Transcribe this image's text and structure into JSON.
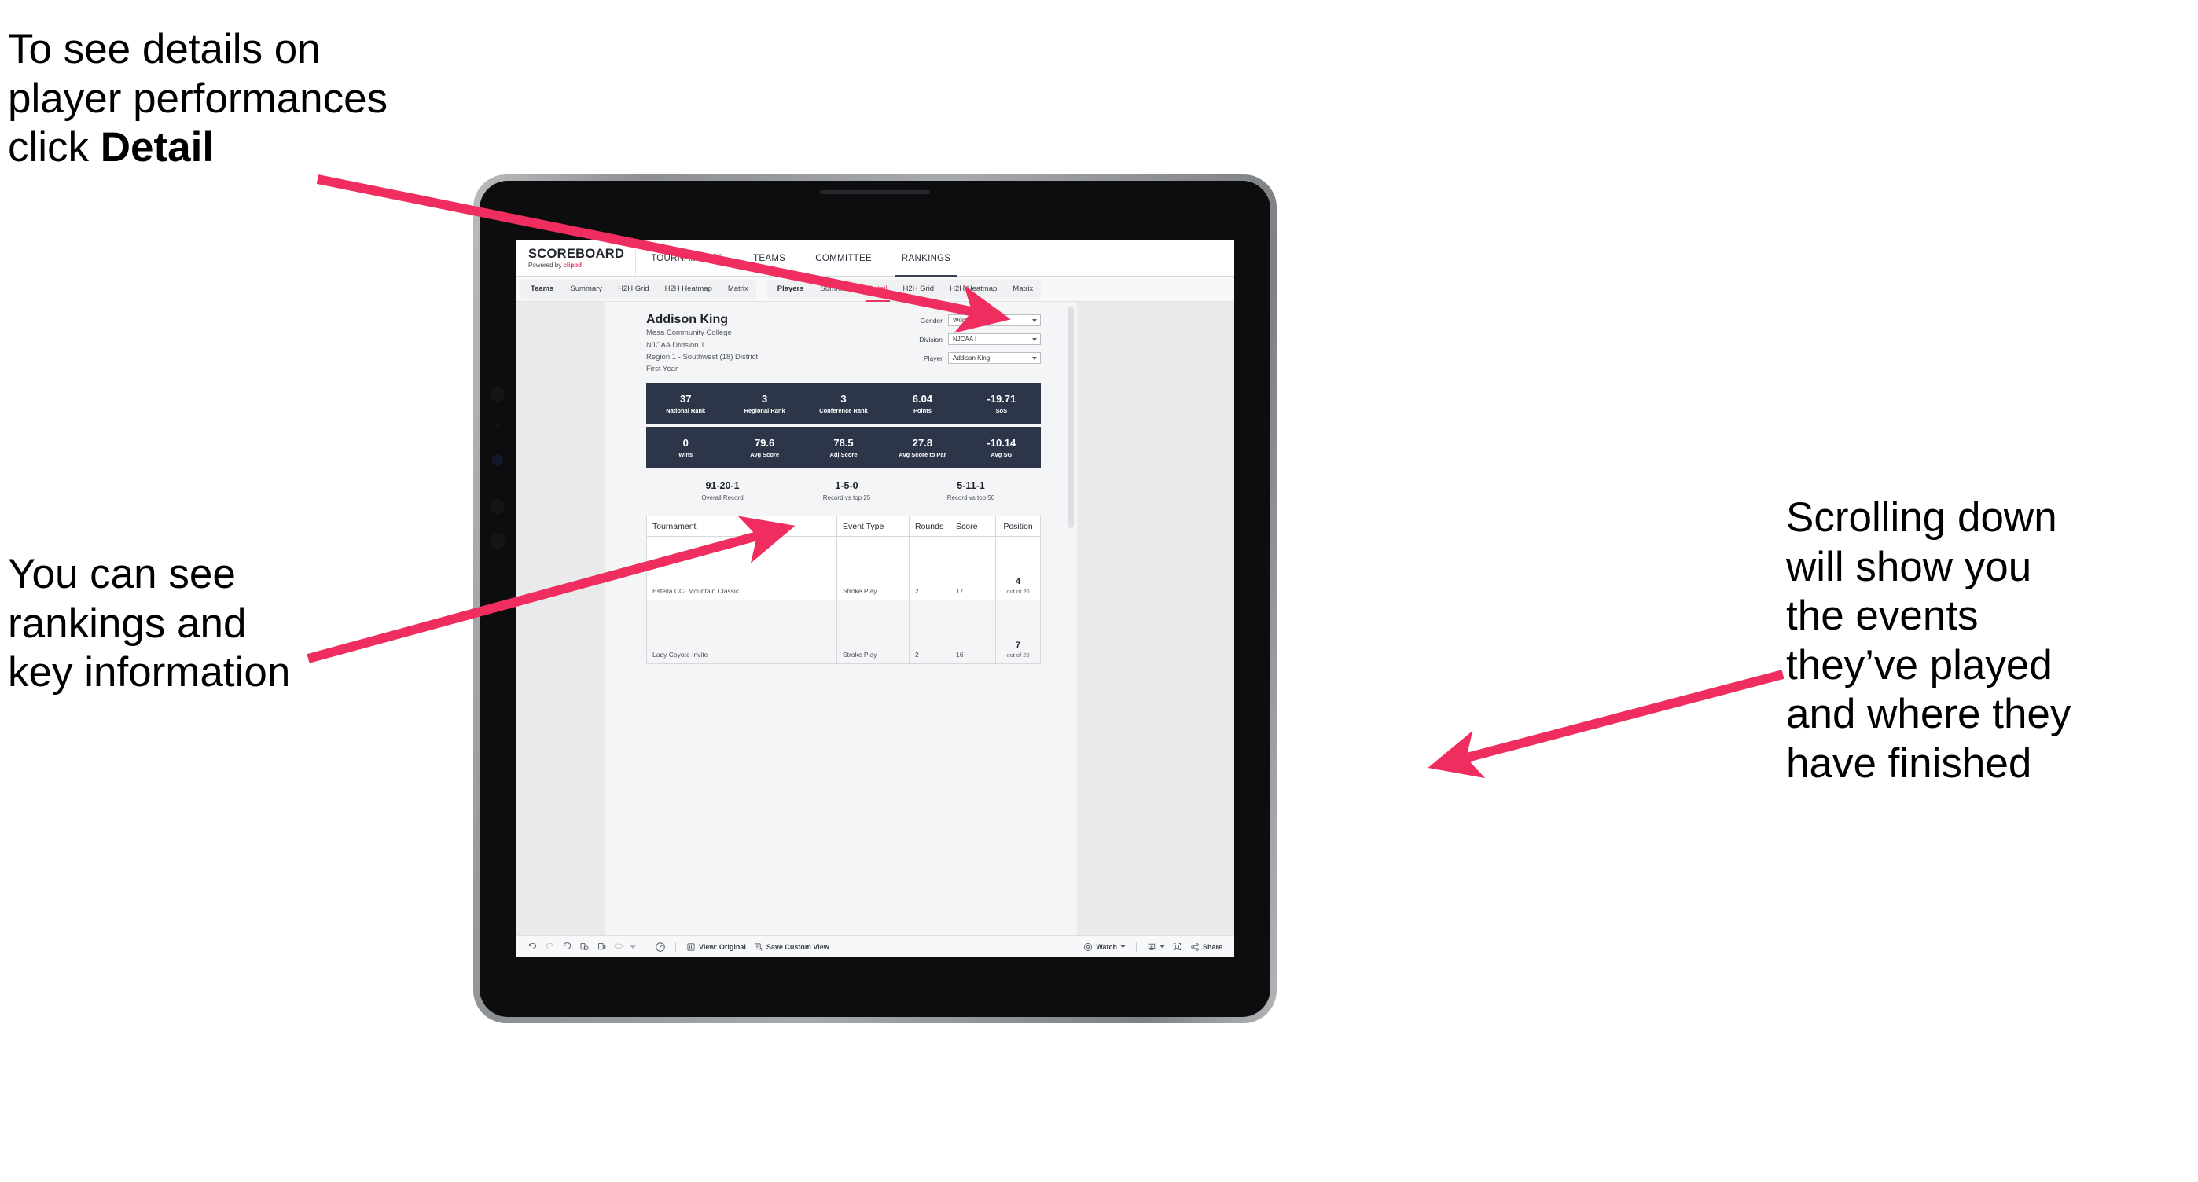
{
  "annotations": {
    "top_left": "To see details on\nplayer performances\nclick ",
    "top_left_bold": "Detail",
    "mid_left": "You can see\nrankings and\nkey information",
    "right": "Scrolling down\nwill show you\nthe events\nthey’ve played\nand where they\nhave finished"
  },
  "app": {
    "brand": {
      "main": "SCOREBOARD",
      "powered_prefix": "Powered by ",
      "powered_accent": "clippd"
    },
    "topnav": [
      {
        "label": "TOURNAMENTS",
        "active": false
      },
      {
        "label": "TEAMS",
        "active": false
      },
      {
        "label": "COMMITTEE",
        "active": false
      },
      {
        "label": "RANKINGS",
        "active": true
      }
    ],
    "subnav": {
      "teams_group": {
        "head": "Teams",
        "items": [
          "Summary",
          "H2H Grid",
          "H2H Heatmap",
          "Matrix"
        ]
      },
      "players_group": {
        "head": "Players",
        "items": [
          "Summary",
          "Detail",
          "H2H Grid",
          "H2H Heatmap",
          "Matrix"
        ],
        "active": "Detail"
      }
    },
    "player": {
      "name": "Addison King",
      "school": "Mesa Community College",
      "division": "NJCAA Division 1",
      "region": "Region 1 - Southwest (18) District",
      "class": "First Year"
    },
    "filters": [
      {
        "label": "Gender",
        "value": "Women"
      },
      {
        "label": "Division",
        "value": "NJCAA I"
      },
      {
        "label": "Player",
        "value": "Addison King"
      }
    ],
    "stats_row_1": [
      {
        "value": "37",
        "label": "National Rank"
      },
      {
        "value": "3",
        "label": "Regional Rank"
      },
      {
        "value": "3",
        "label": "Conference Rank"
      },
      {
        "value": "6.04",
        "label": "Points"
      },
      {
        "value": "-19.71",
        "label": "SoS"
      }
    ],
    "stats_row_2": [
      {
        "value": "0",
        "label": "Wins"
      },
      {
        "value": "79.6",
        "label": "Avg Score"
      },
      {
        "value": "78.5",
        "label": "Adj Score"
      },
      {
        "value": "27.8",
        "label": "Avg Score to Par"
      },
      {
        "value": "-10.14",
        "label": "Avg SG"
      }
    ],
    "records": [
      {
        "value": "91-20-1",
        "label": "Overall Record"
      },
      {
        "value": "1-5-0",
        "label": "Record vs top 25"
      },
      {
        "value": "5-11-1",
        "label": "Record vs top 50"
      }
    ],
    "table": {
      "columns": [
        "Tournament",
        "Event Type",
        "Rounds",
        "Score",
        "Position"
      ],
      "rows": [
        {
          "tournament": "Estella CC- Mountain Classic",
          "event_type": "Stroke Play",
          "rounds": "2",
          "score": "17",
          "position": "4",
          "position_sub": "out of 20"
        },
        {
          "tournament": "Lady Coyote Invite",
          "event_type": "Stroke Play",
          "rounds": "2",
          "score": "16",
          "position": "7",
          "position_sub": "out of 20"
        }
      ]
    },
    "toolbar": {
      "view_label": "View: Original",
      "save_label": "Save Custom View",
      "watch_label": "Watch",
      "share_label": "Share"
    }
  },
  "colors": {
    "accent_pink": "#ea3a60",
    "arrow_pink": "#ef2d5e",
    "stat_navy": "#2d3548",
    "tab_active": "#e4395f"
  }
}
